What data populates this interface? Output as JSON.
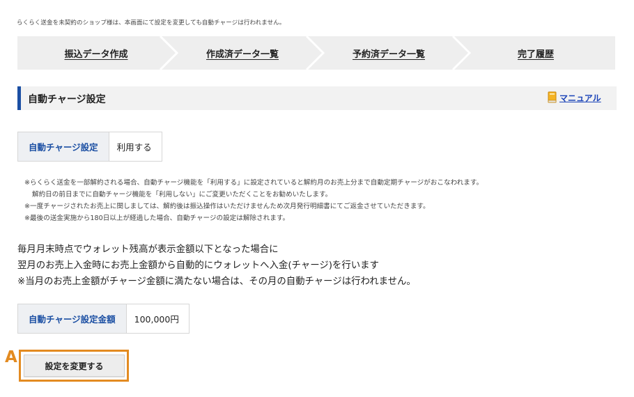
{
  "notice": "らくらく送金を未契約のショップ様は、本画面にて設定を変更しても自動チャージは行われません。",
  "steps": [
    {
      "label": "振込データ作成"
    },
    {
      "label": "作成済データ一覧"
    },
    {
      "label": "予約済データ一覧"
    },
    {
      "label": "完了履歴"
    }
  ],
  "section": {
    "title": "自動チャージ設定",
    "manual_label": "マニュアル",
    "manual_icon": "book-icon"
  },
  "auto_charge": {
    "label": "自動チャージ設定",
    "value": "利用する"
  },
  "notes": [
    "※らくらく送金を一部解約される場合、自動チャージ機能を「利用する」に設定されていると解約月のお売上分まで自動定期チャージがおこなわれます。",
    "解約日の前日までに自動チャージ機能を「利用しない」にご変更いただくことをお勧めいたします。",
    "※一度チャージされたお売上に関しましては、解約後は振込操作はいただけませんため次月発行明細書にてご返金させていただきます。",
    "※最後の送金実施から180日以上が経過した場合、自動チャージの設定は解除されます。"
  ],
  "description": [
    "毎月月末時点でウォレット残高が表示金額以下となった場合に",
    "翌月のお売上入金時にお売上金額から自動的にウォレットへ入金(チャージ)を行います",
    "※当月のお売上金額がチャージ金額に満たない場合は、その月の自動チャージは行われません。"
  ],
  "amount": {
    "label": "自動チャージ設定金額",
    "value": "100,000円"
  },
  "annotation_label": "A",
  "change_button": "設定を変更する",
  "colors": {
    "accent": "#1b4fa3",
    "highlight": "#e38b21",
    "link": "#1a43b8"
  }
}
